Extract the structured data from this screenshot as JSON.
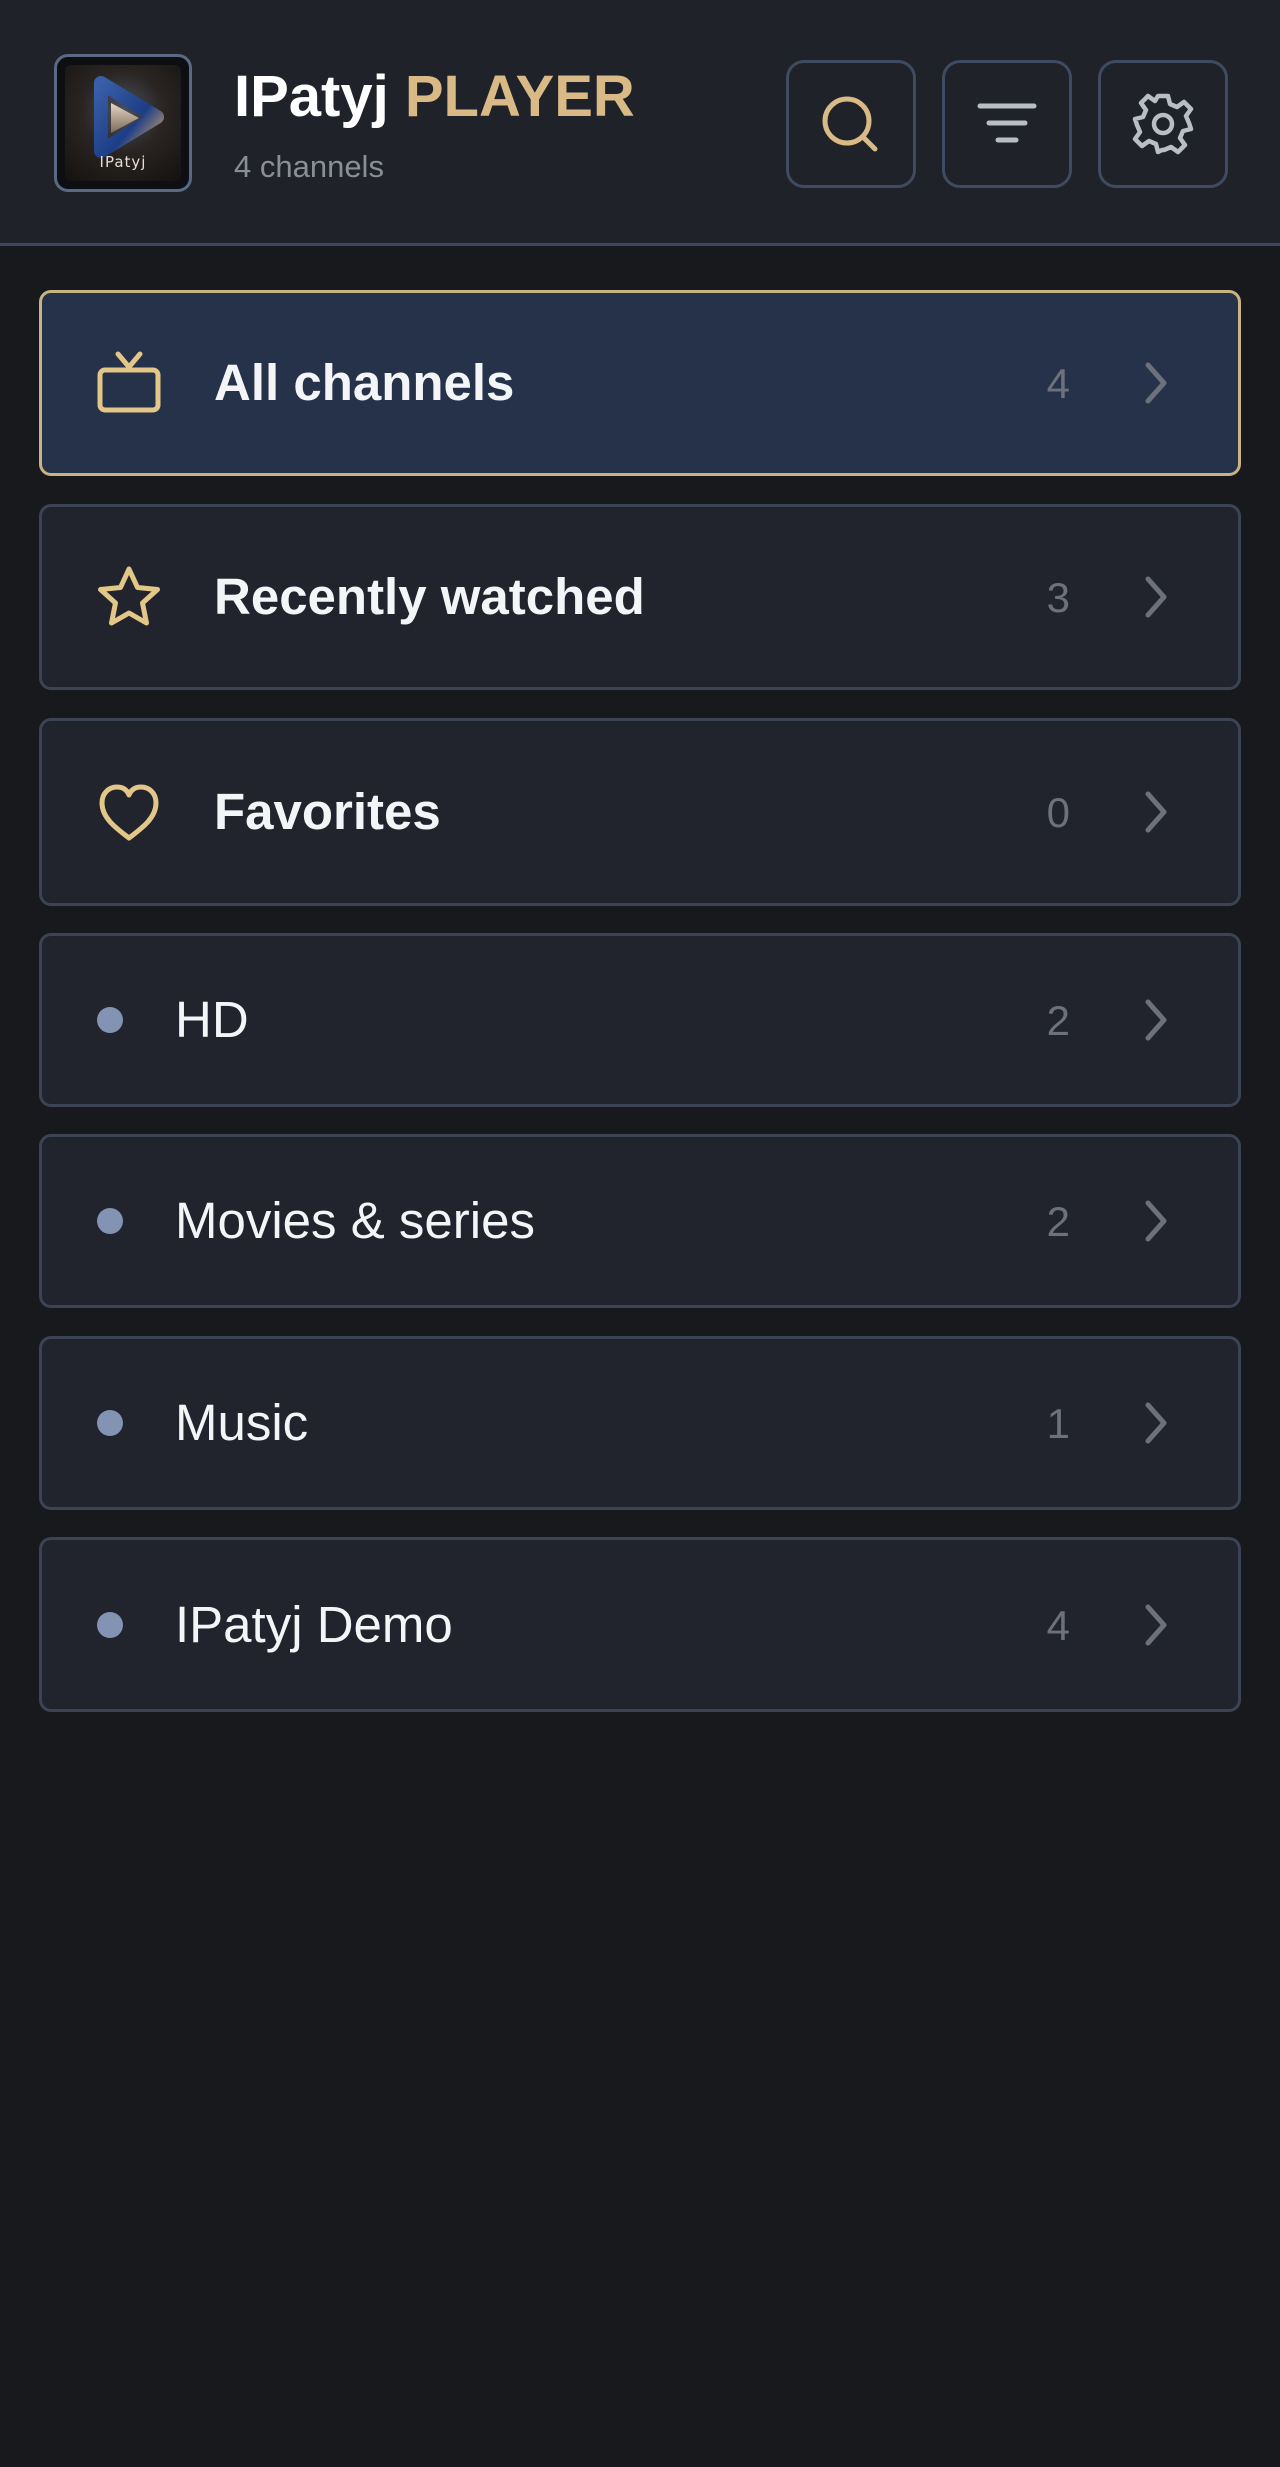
{
  "header": {
    "title_main": "IPatyj",
    "title_accent": "PLAYER",
    "subtitle": "4 channels",
    "logo_text": "IPatyj",
    "buttons": [
      "search-icon",
      "filter-icon",
      "gear-icon"
    ]
  },
  "colors": {
    "accent": "#d9b985",
    "background": "#18191d",
    "header_bg": "#1f2228",
    "row_bg": "#21242c",
    "row_active_bg": "#25324a",
    "row_active_border": "#c9b383",
    "category_dot": "#8293b4"
  },
  "categories": [
    {
      "label": "All channels",
      "count": "4",
      "icon": "tv-icon"
    },
    {
      "label": "Recently watched",
      "count": "3",
      "icon": "star-icon"
    },
    {
      "label": "Favorites",
      "count": "0",
      "icon": "heart-icon"
    },
    {
      "label": "HD",
      "count": "2",
      "icon": "dot"
    },
    {
      "label": "Movies & series",
      "count": "2",
      "icon": "dot"
    },
    {
      "label": "Music",
      "count": "1",
      "icon": "dot"
    },
    {
      "label": "IPatyj Demo",
      "count": "4",
      "icon": "dot"
    }
  ]
}
